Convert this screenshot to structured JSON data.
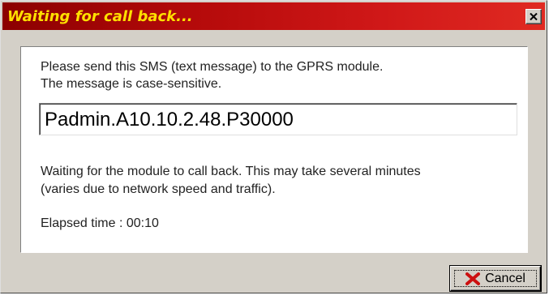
{
  "window": {
    "title": "Waiting for call back...",
    "title_color": "#ffe000",
    "titlebar_color": "#c01010"
  },
  "instructions": {
    "line1": "Please send this SMS (text message) to the GPRS module.",
    "line2": "The message is case-sensitive."
  },
  "sms_field": {
    "value": "Padmin.A10.10.2.48.P30000"
  },
  "status": {
    "line1": "Waiting for the module to call back. This may take several minutes",
    "line2": "(varies due to network speed and traffic).",
    "elapsed": "Elapsed time : 00:10"
  },
  "buttons": {
    "cancel_label": "Cancel",
    "cancel_icon": "red-x-icon",
    "close_icon": "close-icon"
  }
}
